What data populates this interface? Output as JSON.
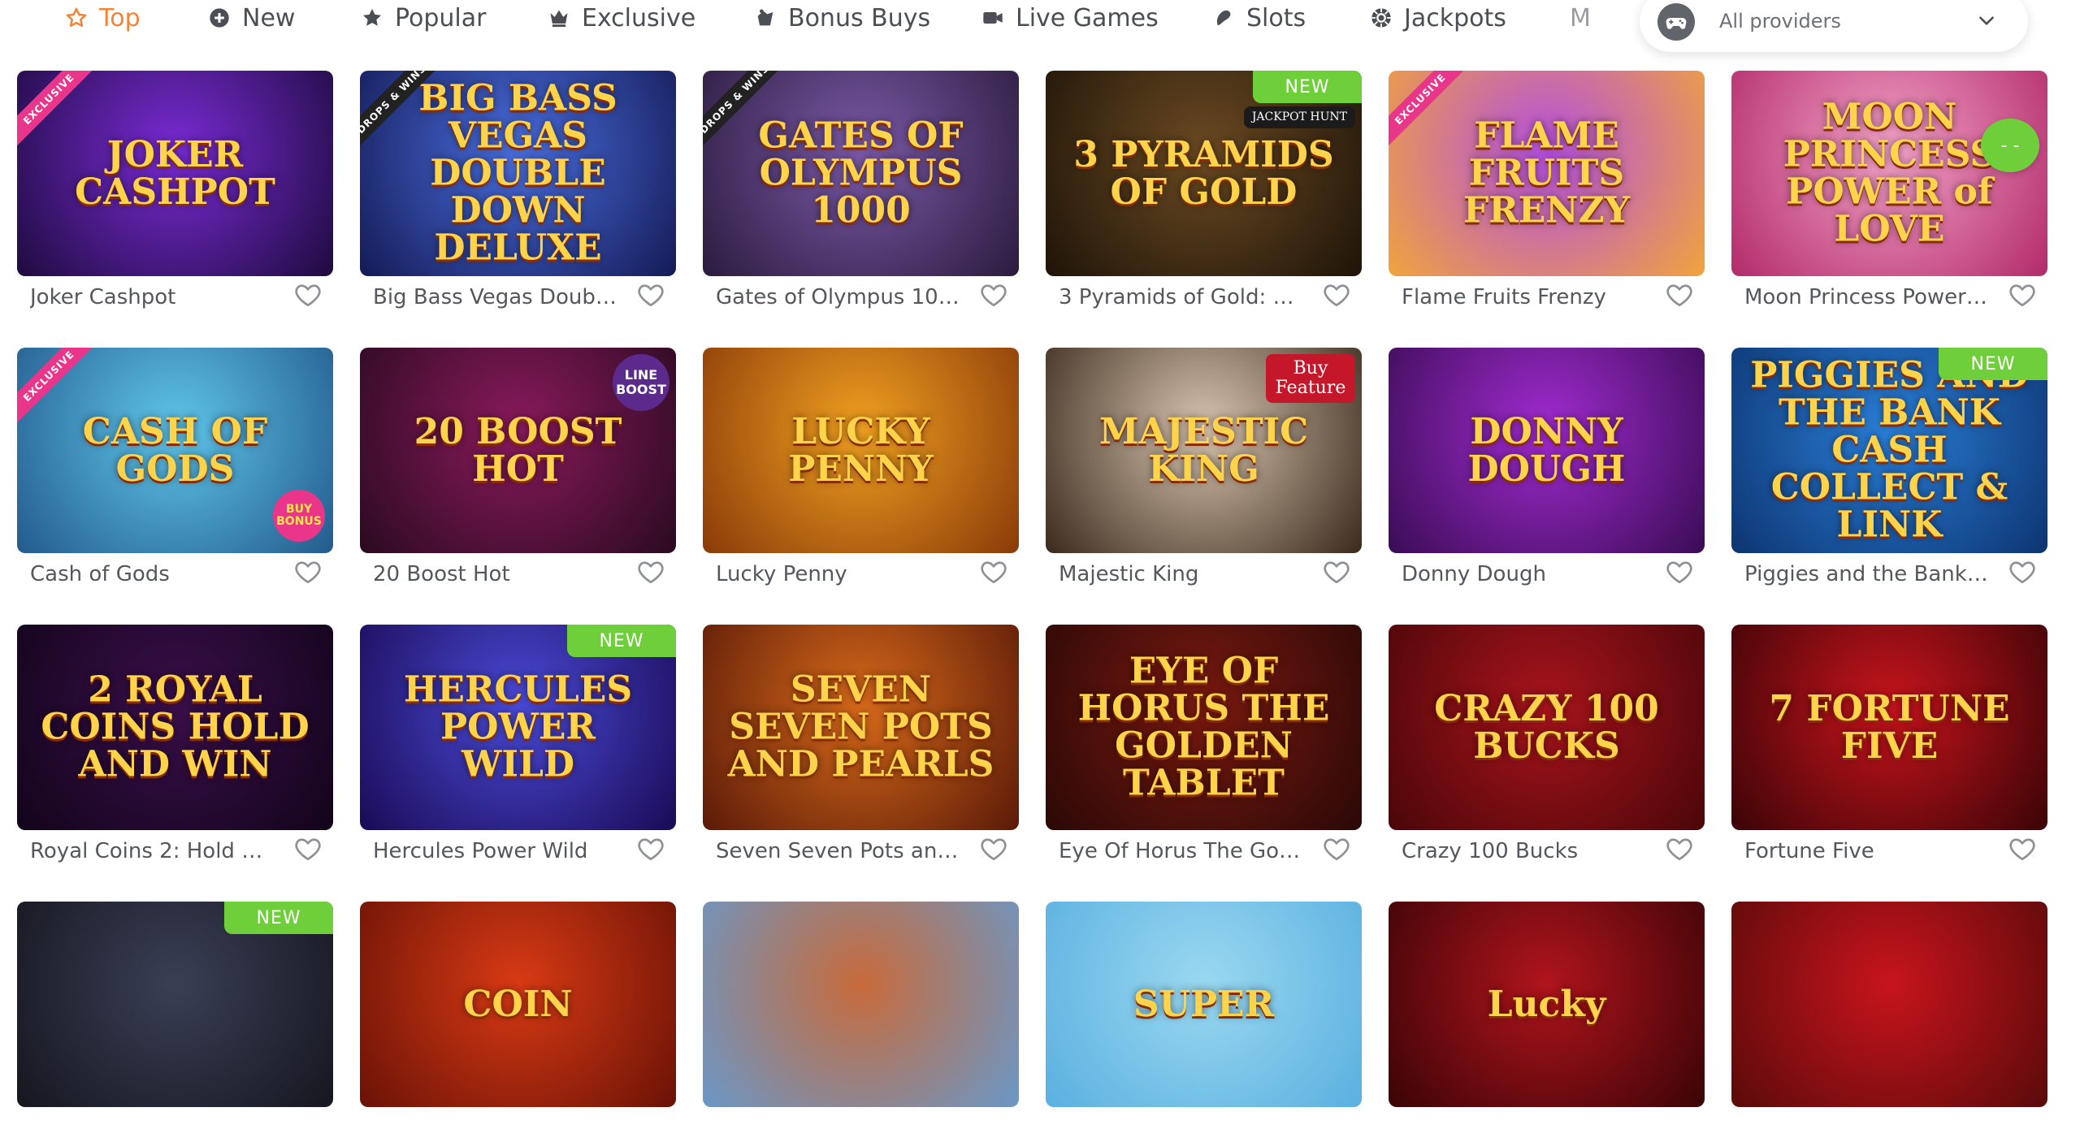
{
  "nav": {
    "tabs": [
      {
        "label": "Top",
        "icon": "star-icon",
        "active": true
      },
      {
        "label": "New",
        "icon": "plus-circle-icon",
        "active": false
      },
      {
        "label": "Popular",
        "icon": "star-filled-icon",
        "active": false
      },
      {
        "label": "Exclusive",
        "icon": "crown-icon",
        "active": false
      },
      {
        "label": "Bonus Buys",
        "icon": "bonus-icon",
        "active": false
      },
      {
        "label": "Live Games",
        "icon": "video-camera-icon",
        "active": false
      },
      {
        "label": "Slots",
        "icon": "slots-icon",
        "active": false
      },
      {
        "label": "Jackpots",
        "icon": "chip-icon",
        "active": false
      },
      {
        "label": "M",
        "icon": "",
        "active": false
      }
    ],
    "scroll_progress": 0.58,
    "progress_colors": [
      "#f5955a",
      "#f0576e"
    ],
    "accent_color": "#f2853a"
  },
  "provider_filter": {
    "value": "All providers",
    "icon": "gamepad-icon"
  },
  "games": [
    {
      "name": "Joker Cashpot",
      "art": "JOKER CASHPOT",
      "bg": [
        "#7a2bd6",
        "#1e0b3f"
      ],
      "ribbon": "EXCLUSIVE"
    },
    {
      "name": "Big Bass Vegas Double ...",
      "art": "BIG BASS VEGAS DOUBLE DOWN DELUXE",
      "bg": [
        "#4a6fe0",
        "#141a55"
      ],
      "ribbon_dark": "DROPS & WINS"
    },
    {
      "name": "Gates of Olympus 1000",
      "art": "GATES OF OLYMPUS 1000",
      "bg": [
        "#7b5aa8",
        "#2b1b3d"
      ],
      "ribbon_dark": "DROPS & WINS"
    },
    {
      "name": "3 Pyramids of Gold: Hol...",
      "art": "3 PYRAMIDS OF GOLD",
      "bg": [
        "#6b4a22",
        "#1e1408"
      ],
      "badge": "NEW",
      "corner": "JACKPOT HUNT"
    },
    {
      "name": "Flame Fruits Frenzy",
      "art": "FLAME FRUITS FRENZY",
      "bg": [
        "#b34fe0",
        "#f1a43c"
      ],
      "ribbon": "EXCLUSIVE"
    },
    {
      "name": "Moon Princess Power o...",
      "art": "MOON PRINCESS POWER of LOVE",
      "bg": [
        "#f3a3c8",
        "#b22a6a"
      ]
    },
    {
      "name": "Cash of Gods",
      "art": "CASH OF GODS",
      "bg": [
        "#5fc6ea",
        "#235a8c"
      ],
      "ribbon": "EXCLUSIVE",
      "corner_pink": "BUY BONUS"
    },
    {
      "name": "20 Boost Hot",
      "art": "20 BOOST HOT",
      "bg": [
        "#8a1a5c",
        "#2a0a20"
      ],
      "corner_purple": "LINE BOOST"
    },
    {
      "name": "Lucky Penny",
      "art": "LUCKY PENNY",
      "bg": [
        "#f0a020",
        "#8a3a08"
      ]
    },
    {
      "name": "Majestic King",
      "art": "MAJESTIC KING",
      "bg": [
        "#d9c5b0",
        "#3a2a1c"
      ],
      "corner_red": "Buy Feature"
    },
    {
      "name": "Donny Dough",
      "art": "DONNY DOUGH",
      "bg": [
        "#a12bd0",
        "#3a0c55"
      ]
    },
    {
      "name": "Piggies and the Bank: C...",
      "art": "PIGGIES AND THE BANK CASH COLLECT & LINK",
      "bg": [
        "#2a7fd8",
        "#0d3470"
      ],
      "badge": "NEW"
    },
    {
      "name": "Royal Coins 2: Hold and...",
      "art": "2 ROYAL COINS HOLD AND WIN",
      "bg": [
        "#3a0f4a",
        "#12041a"
      ]
    },
    {
      "name": "Hercules Power Wild",
      "art": "HERCULES POWER WILD",
      "bg": [
        "#4a4bd8",
        "#1a0a55"
      ],
      "badge": "NEW"
    },
    {
      "name": "Seven Seven Pots and P...",
      "art": "SEVEN SEVEN POTS AND PEARLS",
      "bg": [
        "#d86a1a",
        "#5a1a08"
      ]
    },
    {
      "name": "Eye Of Horus The Gold...",
      "art": "EYE OF HORUS THE GOLDEN TABLET",
      "bg": [
        "#7a1a10",
        "#2a0806"
      ]
    },
    {
      "name": "Crazy 100 Bucks",
      "art": "CRAZY 100 BUCKS",
      "bg": [
        "#a8141c",
        "#4a0608"
      ]
    },
    {
      "name": "Fortune Five",
      "art": "7 FORTUNE FIVE",
      "bg": [
        "#c8141c",
        "#3a0406"
      ]
    },
    {
      "name": "",
      "art": "",
      "bg": [
        "#3a3f55",
        "#15161f"
      ],
      "badge": "NEW"
    },
    {
      "name": "",
      "art": "COIN",
      "bg": [
        "#d83a14",
        "#6a1206"
      ]
    },
    {
      "name": "",
      "art": "",
      "bg": [
        "#c86a3a",
        "#6a98c8"
      ]
    },
    {
      "name": "",
      "art": "SUPER",
      "bg": [
        "#9ad8f0",
        "#5ab0e0"
      ]
    },
    {
      "name": "",
      "art": "Lucky",
      "bg": [
        "#b0141c",
        "#3a0406"
      ]
    },
    {
      "name": "",
      "art": "",
      "bg": [
        "#c8141c",
        "#5a0a0a"
      ]
    }
  ],
  "chat_widget": {
    "icon": "chat-bubble-icon"
  }
}
